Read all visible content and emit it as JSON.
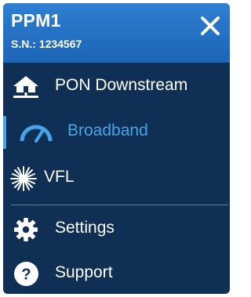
{
  "header": {
    "title": "PPM1",
    "serial": "S.N.: 1234567"
  },
  "menu": {
    "items": [
      {
        "label": "PON Downstream",
        "icon": "home-network-icon",
        "active": false
      },
      {
        "label": "Broadband",
        "icon": "gauge-icon",
        "active": true
      },
      {
        "label": "VFL",
        "icon": "laser-burst-icon",
        "active": false
      },
      {
        "label": "Settings",
        "icon": "gear-icon",
        "active": false
      },
      {
        "label": "Support",
        "icon": "help-circle-icon",
        "active": false
      }
    ]
  },
  "colors": {
    "header": "#1c64b8",
    "background": "#0f2f55",
    "accent": "#46a5e8",
    "text": "#ffffff"
  }
}
